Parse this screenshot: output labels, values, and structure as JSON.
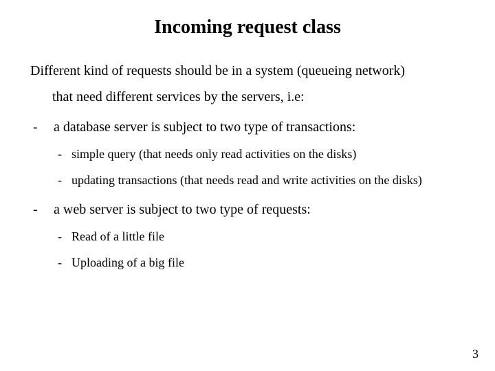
{
  "title": "Incoming request class",
  "intro_line1": "Different kind of requests should be in a system (queueing network)",
  "intro_line2": "that need different services by the servers, i.e:",
  "items": [
    {
      "text": "a database server is subject to two type of transactions:",
      "sub": [
        "simple query (that needs only read activities on the disks)",
        "updating transactions (that needs read and write activities on the disks)"
      ]
    },
    {
      "text": "a web server is subject to two type of requests:",
      "sub": [
        "Read of a little file",
        "Uploading of a big file"
      ]
    }
  ],
  "page_number": "3"
}
